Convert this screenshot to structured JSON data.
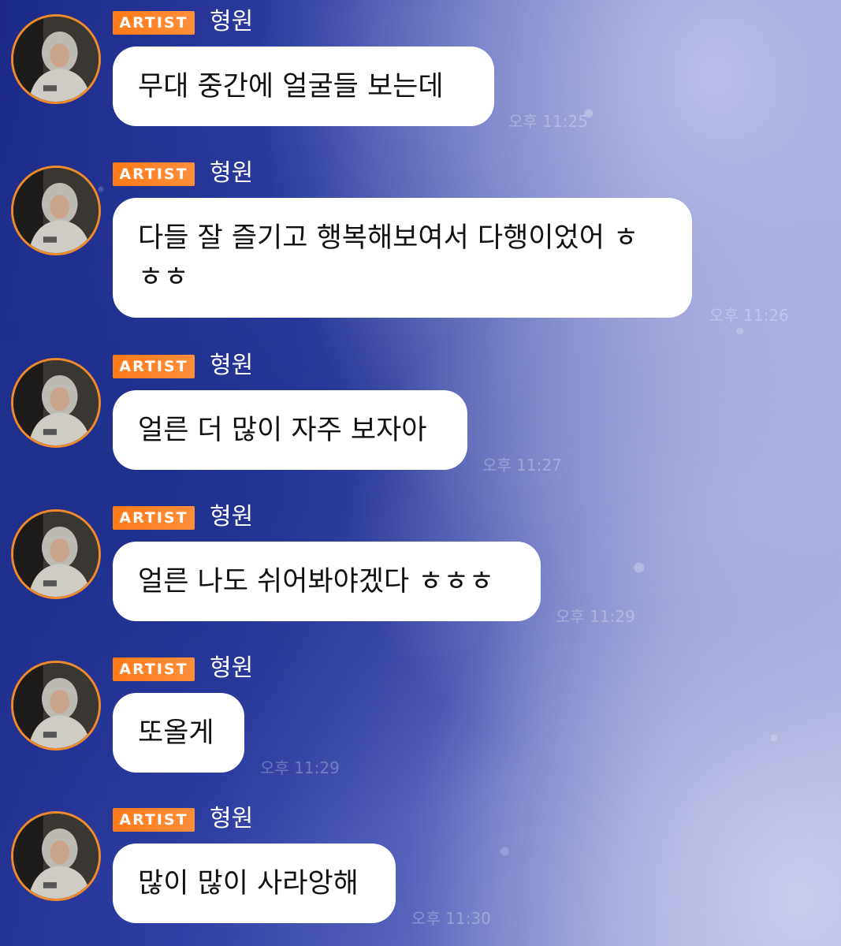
{
  "messages": [
    {
      "badge": "ARTIST",
      "name": "형원",
      "text": "무대 중간에 얼굴들 보는데",
      "time": "오후 11:25"
    },
    {
      "badge": "ARTIST",
      "name": "형원",
      "text": "다들 잘 즐기고 행복해보여서 다행이었어 ㅎㅎㅎ",
      "time": "오후 11:26"
    },
    {
      "badge": "ARTIST",
      "name": "형원",
      "text": "얼른 더 많이 자주 보자아",
      "time": "오후 11:27"
    },
    {
      "badge": "ARTIST",
      "name": "형원",
      "text": "얼른 나도 쉬어봐야겠다 ㅎㅎㅎ",
      "time": "오후 11:29"
    },
    {
      "badge": "ARTIST",
      "name": "형원",
      "text": "또올게",
      "time": "오후 11:29"
    },
    {
      "badge": "ARTIST",
      "name": "형원",
      "text": "많이 많이 사라앙해",
      "time": "오후 11:30"
    }
  ],
  "colors": {
    "badge": "#ff7a1a",
    "avatar_ring": "#f08a2a",
    "bubble": "#ffffff",
    "text": "#111111"
  },
  "icons": {
    "avatar": "profile-photo-hooded-person"
  }
}
